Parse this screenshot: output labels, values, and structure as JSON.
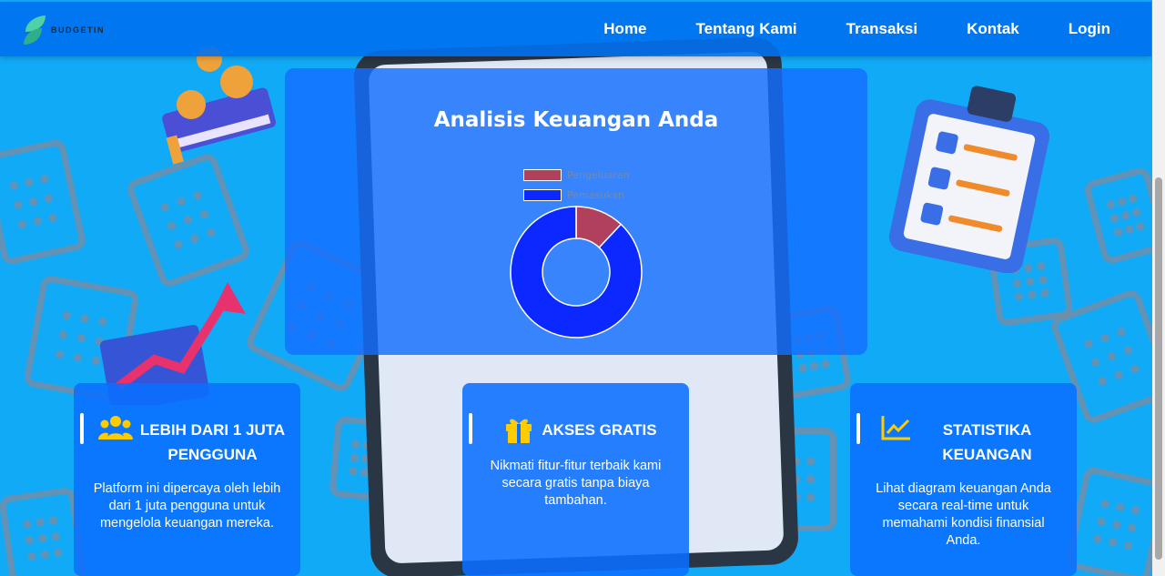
{
  "navbar": {
    "brand": "BUDGETIN",
    "items": [
      {
        "label": "Home"
      },
      {
        "label": "Tentang Kami"
      },
      {
        "label": "Transaksi"
      },
      {
        "label": "Kontak"
      },
      {
        "label": "Login"
      }
    ]
  },
  "analysis": {
    "title": "Analisis Keuangan Anda",
    "legend": [
      {
        "label": "Pengeluaran",
        "color": "#b0405c"
      },
      {
        "label": "Pemasukan",
        "color": "#0a28ff"
      }
    ]
  },
  "chart_data": {
    "type": "pie",
    "series": [
      {
        "name": "Pengeluaran",
        "value": 12,
        "color": "#b0405c"
      },
      {
        "name": "Pemasukan",
        "value": 88,
        "color": "#0a28ff"
      }
    ]
  },
  "cards": [
    {
      "icon": "users-icon",
      "title": "LEBIH DARI 1 JUTA PENGGUNA",
      "text": "Platform ini dipercaya oleh lebih dari 1 juta pengguna untuk mengelola keuangan mereka."
    },
    {
      "icon": "gift-icon",
      "title": "AKSES GRATIS",
      "text": "Nikmati fitur-fitur terbaik kami secara gratis tanpa biaya tambahan."
    },
    {
      "icon": "chart-line-icon",
      "title": "STATISTIKA KEUANGAN",
      "text": "Lihat diagram keuangan Anda secara real-time untuk memahami kondisi finansial Anda."
    }
  ],
  "colors": {
    "icon_yellow": "#ffcc00",
    "nav_bg": "#0070f0"
  }
}
